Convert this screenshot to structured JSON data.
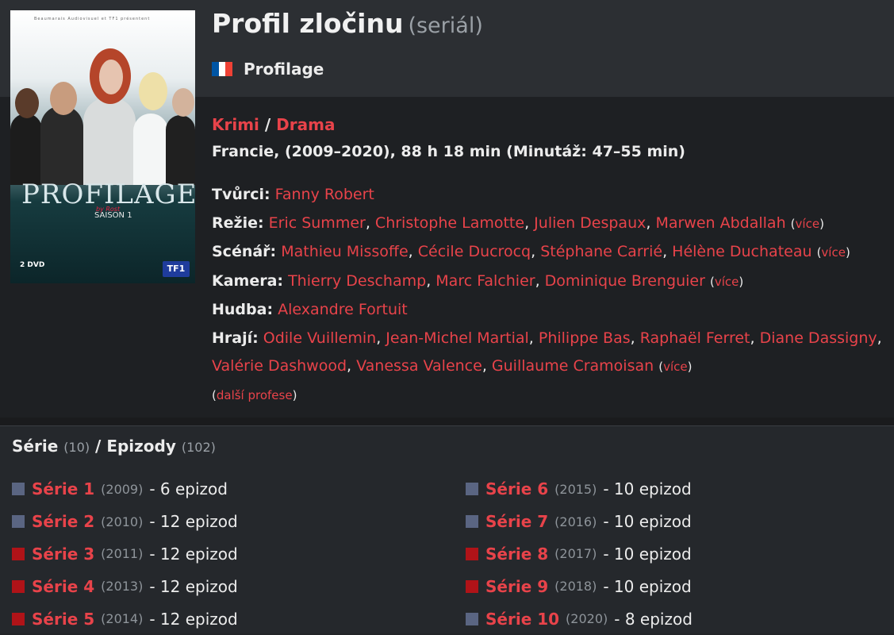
{
  "title": "Profil zločinu",
  "kind": "(seriál)",
  "original_title": "Profilage",
  "flag_colors": [
    "#0055A4",
    "#FFFFFF",
    "#EF4135"
  ],
  "genres": [
    "Krimi",
    "Drama"
  ],
  "genre_sep": "/",
  "origin": "Francie, (2009–2020), 88 h 18 min (Minutáž: 47–55 min)",
  "poster": {
    "presents": "Beaumarais Audiovisuel et TF1 présentent",
    "title": "PROFILAGE",
    "by": "by Rost",
    "season": "SAISON 1",
    "logo": "TF1",
    "dvd": "2 DVD"
  },
  "creators": {
    "tvurci_label": "Tvůrci:",
    "tvurci": [
      "Fanny Robert"
    ],
    "rezie_label": "Režie:",
    "rezie": [
      "Eric Summer",
      "Christophe Lamotte",
      "Julien Despaux",
      "Marwen Abdallah"
    ],
    "scenar_label": "Scénář:",
    "scenar": [
      "Mathieu Missoffe",
      "Cécile Ducrocq",
      "Stéphane Carrié",
      "Hélène Duchateau"
    ],
    "kamera_label": "Kamera:",
    "kamera": [
      "Thierry Deschamp",
      "Marc Falchier",
      "Dominique Brenguier"
    ],
    "hudba_label": "Hudba:",
    "hudba": [
      "Alexandre Fortuit"
    ],
    "hraji_label": "Hrají:",
    "hraji": [
      "Odile Vuillemin",
      "Jean-Michel Martial",
      "Philippe Bas",
      "Raphaël Ferret",
      "Diane Dassigny",
      "Valérie Dashwood",
      "Vanessa Valence",
      "Guillaume Cramoisan"
    ],
    "more_label": "více",
    "other_professions": "další profese"
  },
  "episodes": {
    "series_label": "Série",
    "series_count": "(10)",
    "sep": "/",
    "episodes_label": "Epizody",
    "episodes_count": "(102)",
    "seasons": [
      {
        "name": "Série 1",
        "year": "(2009)",
        "count": "- 6 epizod",
        "color": "#5a6582"
      },
      {
        "name": "Série 2",
        "year": "(2010)",
        "count": "- 12 epizod",
        "color": "#5a6582"
      },
      {
        "name": "Série 3",
        "year": "(2011)",
        "count": "- 12 epizod",
        "color": "#b01318"
      },
      {
        "name": "Série 4",
        "year": "(2013)",
        "count": "- 12 epizod",
        "color": "#b01318"
      },
      {
        "name": "Série 5",
        "year": "(2014)",
        "count": "- 12 epizod",
        "color": "#b01318"
      },
      {
        "name": "Série 6",
        "year": "(2015)",
        "count": "- 10 epizod",
        "color": "#5a6582"
      },
      {
        "name": "Série 7",
        "year": "(2016)",
        "count": "- 10 epizod",
        "color": "#5a6582"
      },
      {
        "name": "Série 8",
        "year": "(2017)",
        "count": "- 10 epizod",
        "color": "#b01318"
      },
      {
        "name": "Série 9",
        "year": "(2018)",
        "count": "- 10 epizod",
        "color": "#b01318"
      },
      {
        "name": "Série 10",
        "year": "(2020)",
        "count": "- 8 epizod",
        "color": "#5a6582"
      }
    ]
  }
}
